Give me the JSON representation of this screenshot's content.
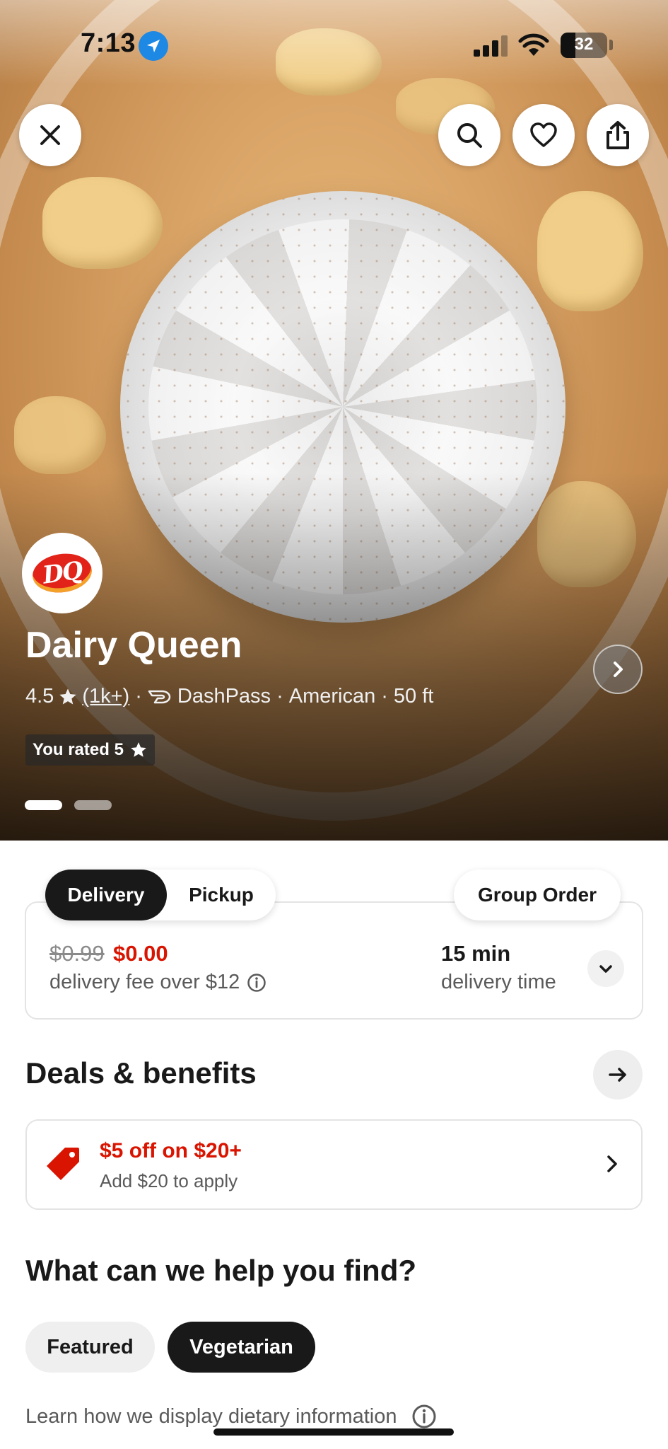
{
  "status_bar": {
    "time": "7:13",
    "battery": "32"
  },
  "top_actions": {
    "close_icon": "close-icon",
    "search_icon": "search-icon",
    "favorite_icon": "heart-icon",
    "share_icon": "share-icon"
  },
  "store": {
    "logo_text": "DQ",
    "name": "Dairy Queen",
    "rating": "4.5",
    "review_count": "(1k+)",
    "dashpass": "DashPass",
    "cuisine": "American",
    "distance": "50 ft",
    "meta_separator": "·",
    "you_rated": "You rated 5"
  },
  "carousel": {
    "active_index": 0,
    "count": 2
  },
  "order_mode": {
    "delivery_label": "Delivery",
    "pickup_label": "Pickup",
    "selected": "Delivery",
    "group_order_label": "Group Order"
  },
  "delivery_info": {
    "old_fee": "$0.99",
    "new_fee": "$0.00",
    "fee_label": "delivery fee over $12",
    "time_value": "15 min",
    "time_label": "delivery time"
  },
  "deals": {
    "section_title": "Deals & benefits",
    "items": [
      {
        "title": "$5 off on $20+",
        "subtitle": "Add $20 to apply"
      }
    ]
  },
  "find": {
    "section_title": "What can we help you find?",
    "pills": [
      {
        "label": "Featured",
        "selected": false
      },
      {
        "label": "Vegetarian",
        "selected": true
      }
    ],
    "dietary_info": "Learn how we display dietary information"
  },
  "colors": {
    "accent_red": "#d91400",
    "dark": "#191919",
    "muted": "#5a5a5a"
  }
}
